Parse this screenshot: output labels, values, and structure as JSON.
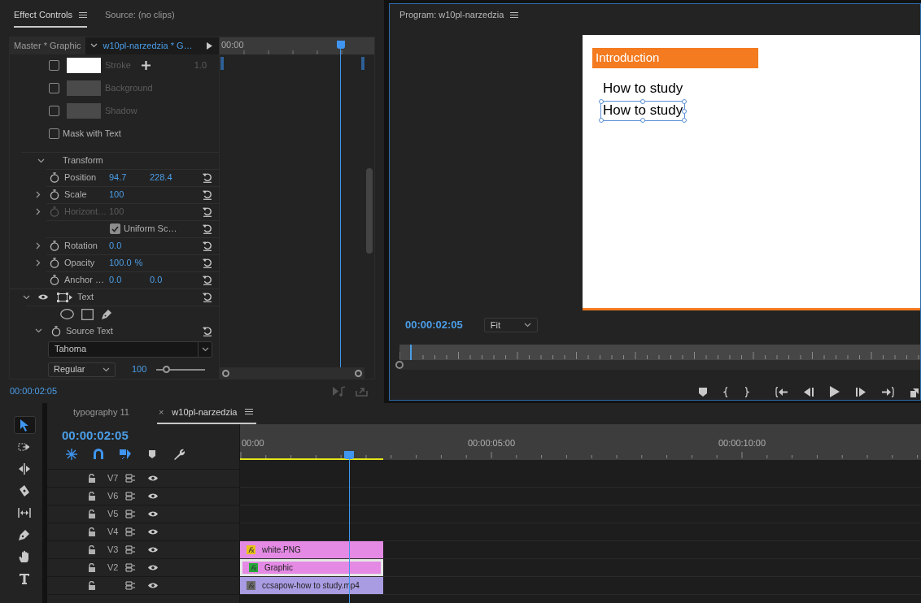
{
  "effect_controls": {
    "tabs": [
      {
        "label": "Effect Controls",
        "selected": true
      },
      {
        "label": "Source: (no clips)",
        "selected": false
      }
    ],
    "master_label": "Master * Graphic",
    "clip_label": "w10pl-narzedzia * G…",
    "ruler_label": "00:00",
    "playhead": {
      "level": 0.78
    },
    "appearance": [
      {
        "label": "Stroke",
        "checked": false,
        "swatch": {
          "color": "#ffffff"
        },
        "addable": true,
        "value": "1.0"
      },
      {
        "label": "Background",
        "checked": false,
        "swatch": {
          "color": "#4a4a4a"
        },
        "addable": false
      },
      {
        "label": "Shadow",
        "checked": false,
        "swatch": {
          "color": "#4a4a4a"
        },
        "addable": false
      }
    ],
    "mask_with_text": {
      "label": "Mask with Text",
      "checked": false
    },
    "transform": {
      "label": "Transform",
      "expanded": true,
      "properties": [
        {
          "kind": "value",
          "label": "Position",
          "expandable": false,
          "disabled": false,
          "values": [
            "94.7",
            "228.4"
          ]
        },
        {
          "kind": "value",
          "label": "Scale",
          "expandable": true,
          "disabled": false,
          "values": [
            "100"
          ]
        },
        {
          "kind": "value",
          "label": "Horizont…",
          "expandable": true,
          "disabled": true,
          "values": [
            "100"
          ]
        },
        {
          "kind": "checkbox",
          "label": "Uniform Sc…",
          "checked": true
        },
        {
          "kind": "value",
          "label": "Rotation",
          "expandable": true,
          "disabled": false,
          "values": [
            "0.0"
          ]
        },
        {
          "kind": "value",
          "label": "Opacity",
          "expandable": true,
          "disabled": false,
          "values": [
            "100.0"
          ],
          "unit": "%"
        },
        {
          "kind": "value",
          "label": "Anchor …",
          "expandable": false,
          "disabled": false,
          "values": [
            "0.0",
            "0.0"
          ]
        }
      ]
    },
    "text_layer": {
      "label": "Text",
      "expanded": true,
      "visible": true,
      "source_text": {
        "label": "Source Text",
        "expanded": true,
        "font": "Tahoma",
        "style": "Regular",
        "size": "100",
        "size_slider": {
          "level": 0.2
        }
      }
    },
    "timecode": "00:00:02:05"
  },
  "program": {
    "title": "Program: w10pl-narzedzia",
    "frame": {
      "heading": "Introduction",
      "lines": [
        {
          "text": "How to study",
          "selected": false
        },
        {
          "text": "How to study",
          "selected": true
        }
      ]
    },
    "timecode": "00:00:02:05",
    "zoom": "Fit",
    "playhead": {
      "level": 0.02
    }
  },
  "tools": [
    {
      "kind": "selection",
      "selected": true
    },
    {
      "kind": "track-select",
      "selected": false
    },
    {
      "kind": "ripple",
      "selected": false
    },
    {
      "kind": "razor",
      "selected": false
    },
    {
      "kind": "slip",
      "selected": false
    },
    {
      "kind": "pen",
      "selected": false
    },
    {
      "kind": "hand",
      "selected": false
    },
    {
      "kind": "type",
      "selected": false
    }
  ],
  "timeline": {
    "tabs": [
      {
        "label": "typography 11",
        "selected": false
      },
      {
        "label": "w10pl-narzedzia",
        "selected": true,
        "close": "×"
      }
    ],
    "timecode": "00:00:02:05",
    "toggles": [
      {
        "kind": "nest",
        "on": true
      },
      {
        "kind": "snap",
        "on": true
      },
      {
        "kind": "linked",
        "on": true
      },
      {
        "kind": "marker",
        "on": false
      },
      {
        "kind": "settings",
        "on": false
      }
    ],
    "ruler_labels": [
      "00:00",
      "00:00:05:00",
      "00:00:10:00"
    ],
    "playhead": {
      "level": 0.16
    },
    "work_area": {
      "level": 0.21
    },
    "tracks": [
      {
        "name": "V7"
      },
      {
        "name": "V6"
      },
      {
        "name": "V5"
      },
      {
        "name": "V4"
      },
      {
        "name": "V3",
        "clip": {
          "label": "white.PNG",
          "color": "#e48ae4",
          "fx": {
            "color": "#e8c21a"
          },
          "selected": false
        }
      },
      {
        "name": "V2",
        "clip": {
          "label": "Graphic",
          "color": "#e48ae4",
          "fx": {
            "color": "#27a83a"
          },
          "selected": true
        }
      },
      {
        "clip": {
          "label": "ccsapow-how to study.mp4",
          "color": "#a99ce2",
          "fx": {
            "color": "#6a6a6a"
          },
          "selected": false
        }
      }
    ]
  }
}
